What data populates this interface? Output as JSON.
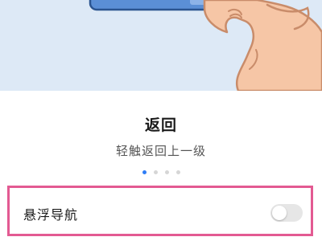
{
  "gesture": {
    "title": "返回",
    "description": "轻触返回上一级"
  },
  "pager": {
    "page_count": 4,
    "current_page": 1
  },
  "settings": {
    "floating_nav_label": "悬浮导航",
    "floating_nav_enabled": false
  },
  "colors": {
    "illustration_bg": "#dde9f6",
    "accent": "#2f7df6",
    "highlight_border": "#e35a92",
    "hand_skin": "#f6c6a6",
    "device_bar": "#5b8fd6"
  },
  "icons": [
    "hand-tap-illustration",
    "device-bar-illustration"
  ]
}
